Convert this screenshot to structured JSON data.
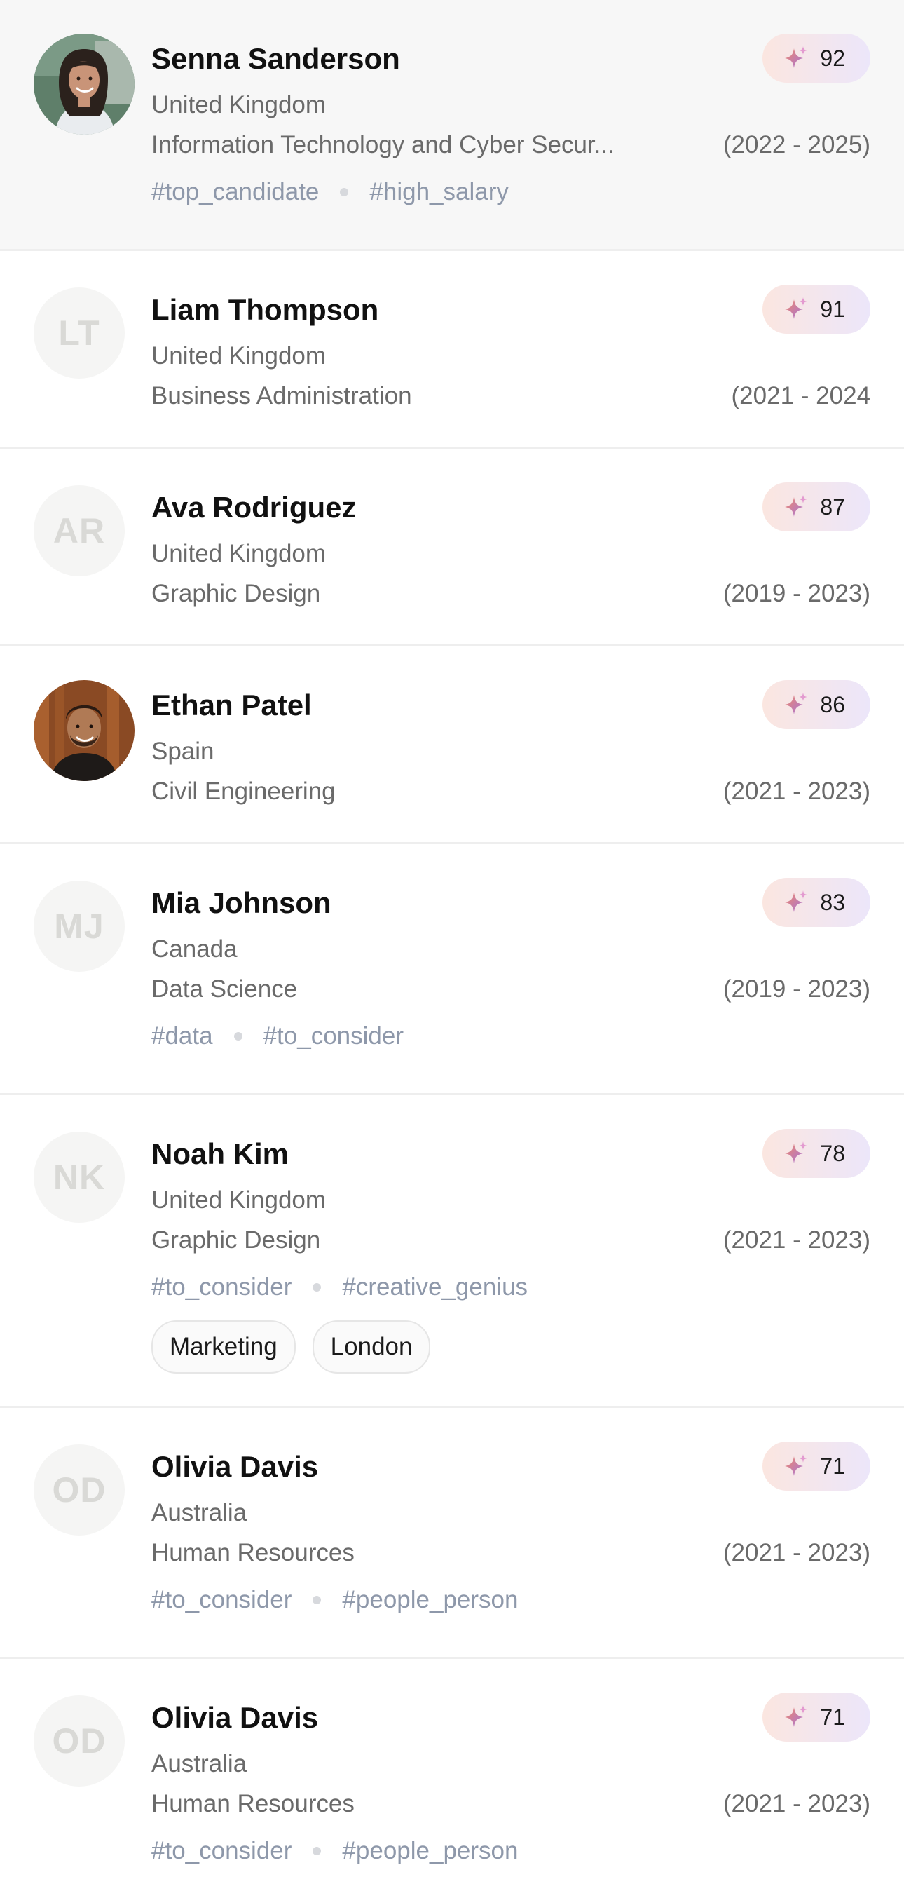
{
  "candidates": [
    {
      "name": "Senna Sanderson",
      "country": "United Kingdom",
      "field": "Information Technology and Cyber Secur...",
      "years": "(2022 - 2025)",
      "score": "92",
      "tags": [
        "#top_candidate",
        "#high_salary"
      ],
      "chips": [],
      "avatar": "photo-woman",
      "initials": ""
    },
    {
      "name": "Liam Thompson",
      "country": "United Kingdom",
      "field": "Business Administration",
      "years": "(2021 - 2024",
      "score": "91",
      "tags": [],
      "chips": [],
      "avatar": "initials",
      "initials": "LT"
    },
    {
      "name": "Ava Rodriguez",
      "country": "United Kingdom",
      "field": "Graphic Design",
      "years": "(2019 - 2023)",
      "score": "87",
      "tags": [],
      "chips": [],
      "avatar": "initials",
      "initials": "AR"
    },
    {
      "name": "Ethan Patel",
      "country": "Spain",
      "field": "Civil Engineering",
      "years": "(2021 - 2023)",
      "score": "86",
      "tags": [],
      "chips": [],
      "avatar": "photo-man",
      "initials": ""
    },
    {
      "name": "Mia Johnson",
      "country": "Canada",
      "field": "Data Science",
      "years": "(2019 - 2023)",
      "score": "83",
      "tags": [
        "#data",
        "#to_consider"
      ],
      "chips": [],
      "avatar": "initials",
      "initials": "MJ"
    },
    {
      "name": "Noah Kim",
      "country": "United Kingdom",
      "field": "Graphic Design",
      "years": "(2021 - 2023)",
      "score": "78",
      "tags": [
        "#to_consider",
        "#creative_genius"
      ],
      "chips": [
        "Marketing",
        "London"
      ],
      "avatar": "initials",
      "initials": "NK"
    },
    {
      "name": "Olivia Davis",
      "country": "Australia",
      "field": "Human Resources",
      "years": "(2021 - 2023)",
      "score": "71",
      "tags": [
        "#to_consider",
        "#people_person"
      ],
      "chips": [],
      "avatar": "initials",
      "initials": "OD"
    },
    {
      "name": "Olivia Davis",
      "country": "Australia",
      "field": "Human Resources",
      "years": "(2021 - 2023)",
      "score": "71",
      "tags": [
        "#to_consider",
        "#people_person"
      ],
      "chips": [],
      "avatar": "initials",
      "initials": "OD"
    }
  ],
  "selected_index": 0,
  "colors": {
    "selected_bg": "#f7f7f7",
    "tag_text": "#8e98aa",
    "score_gradient_start": "#fbe6e0",
    "score_gradient_end": "#ece6fa"
  },
  "icons": {
    "score": "sparkle-icon"
  }
}
